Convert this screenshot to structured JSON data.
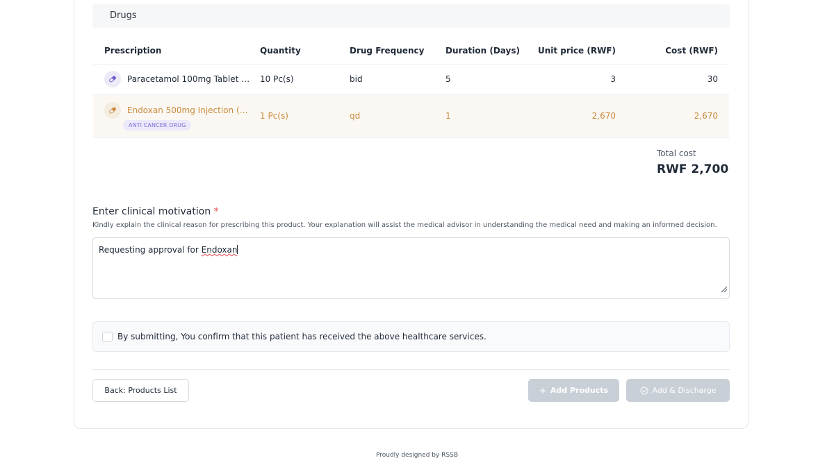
{
  "section": {
    "title": "Drugs"
  },
  "table": {
    "headers": {
      "prescription": "Prescription",
      "quantity": "Quantity",
      "frequency": "Drug Frequency",
      "duration": "Duration (Days)",
      "unit_price": "Unit price (RWF)",
      "cost": "Cost (RWF)"
    },
    "rows": [
      {
        "name": "Paracetamol 100mg Tablet (Par...",
        "quantity": "10 Pc(s)",
        "frequency": "bid",
        "duration": "5",
        "unit_price": "3",
        "cost": "30",
        "icon": "pill-icon"
      },
      {
        "name": "Endoxan 500mg Injection (Cycl...",
        "badge": "ANTI CANCER DRUG",
        "quantity": "1 Pc(s)",
        "frequency": "qd",
        "duration": "1",
        "unit_price": "2,670",
        "cost": "2,670",
        "icon": "pill-icon",
        "highlight_color": "#c88a3b"
      }
    ]
  },
  "total": {
    "label": "Total cost",
    "value": "RWF 2,700"
  },
  "motivation": {
    "label": "Enter clinical motivation",
    "required_mark": "*",
    "help": "Kindly explain the clinical reason for prescribing this product. Your explanation will assist the medical advisor in understanding the medical need and making an informed decision.",
    "value_prefix": "Requesting approval for ",
    "value_word": "Endoxan"
  },
  "confirm": {
    "checked": false,
    "text": "By submitting, You confirm that this patient has received the above healthcare services."
  },
  "buttons": {
    "back": "Back: Products List",
    "add_products": "Add Products",
    "add_discharge": "Add & Discharge"
  },
  "footer": {
    "text": "Proudly designed by RSSB"
  },
  "colors": {
    "accent_orange": "#c88a3b",
    "badge_purple": "#7c6fd6",
    "disabled": "#c9cfd6"
  }
}
